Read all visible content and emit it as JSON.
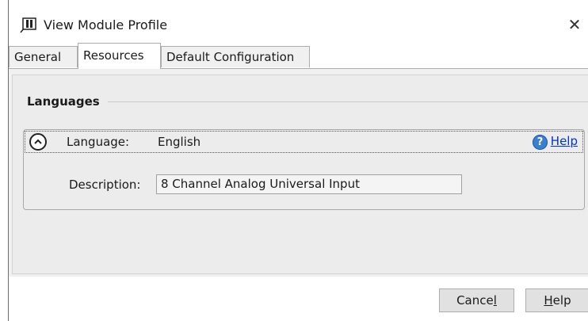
{
  "window": {
    "title": "View Module Profile",
    "close_glyph": "✕",
    "icon": "module-profile-icon"
  },
  "tabs": [
    {
      "label": "General",
      "active": false
    },
    {
      "label": "Resources",
      "active": true
    },
    {
      "label": "Default Configuration",
      "active": false
    }
  ],
  "section": {
    "title": "Languages"
  },
  "language_entry": {
    "expanded": true,
    "language_label": "Language:",
    "language_value": "English",
    "help_label": "Help",
    "description_label": "Description:",
    "description_value": "8 Channel Analog Universal Input"
  },
  "footer": {
    "cancel_prefix": "Cance",
    "cancel_mnemonic": "l",
    "help_mnemonic": "H",
    "help_rest": "elp"
  }
}
